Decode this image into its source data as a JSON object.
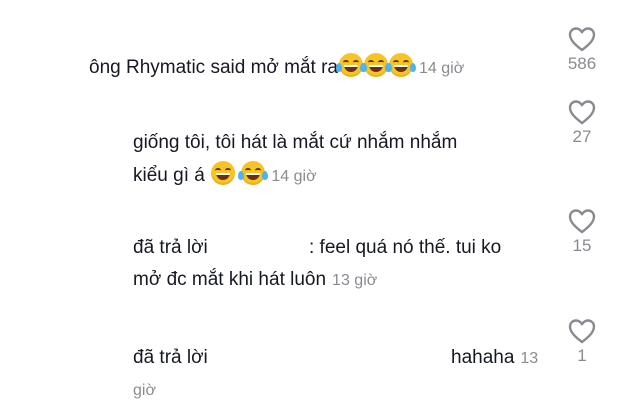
{
  "comments": [
    {
      "prefix": "ông Rhymatic said mở mắt ra",
      "time": "14 giờ",
      "likes": "586"
    },
    {
      "line1": "giống tôi, tôi hát là mắt cứ nhắm nhắm",
      "line2": "kiểu gì á",
      "time": "14 giờ",
      "likes": "27"
    },
    {
      "reply_label": "đã trả lời",
      "line1_rest": ": feel quá nó thế. tui ko",
      "line2": "mở đc mắt khi hát luôn",
      "time": "13 giờ",
      "likes": "15"
    },
    {
      "reply_label": "đã trả lời",
      "text": "hahaha",
      "time_a": "13",
      "time_b": "giờ",
      "likes": "1"
    }
  ],
  "icons": {
    "like": "heart-outline-icon",
    "laugh": "face-with-tears-of-joy-icon",
    "grin": "grinning-face-icon"
  },
  "colors": {
    "text": "#161823",
    "muted": "#8a8b91",
    "icon": "#8a8b91"
  }
}
